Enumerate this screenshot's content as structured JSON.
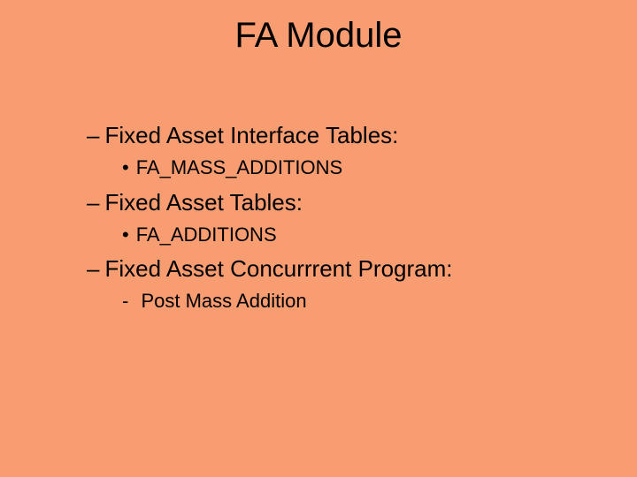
{
  "title": "FA Module",
  "sections": [
    {
      "dash": "–",
      "heading": "Fixed Asset Interface Tables:",
      "subBullet": "•",
      "subtext": "FA_MASS_ADDITIONS"
    },
    {
      "dash": "–",
      "heading": "Fixed Asset Tables:",
      "subBullet": "•",
      "subtext": "FA_ADDITIONS"
    },
    {
      "dash": "–",
      "heading": "Fixed Asset Concurrrent Program:",
      "subBullet": "-",
      "subtext": "Post Mass Addition"
    }
  ]
}
